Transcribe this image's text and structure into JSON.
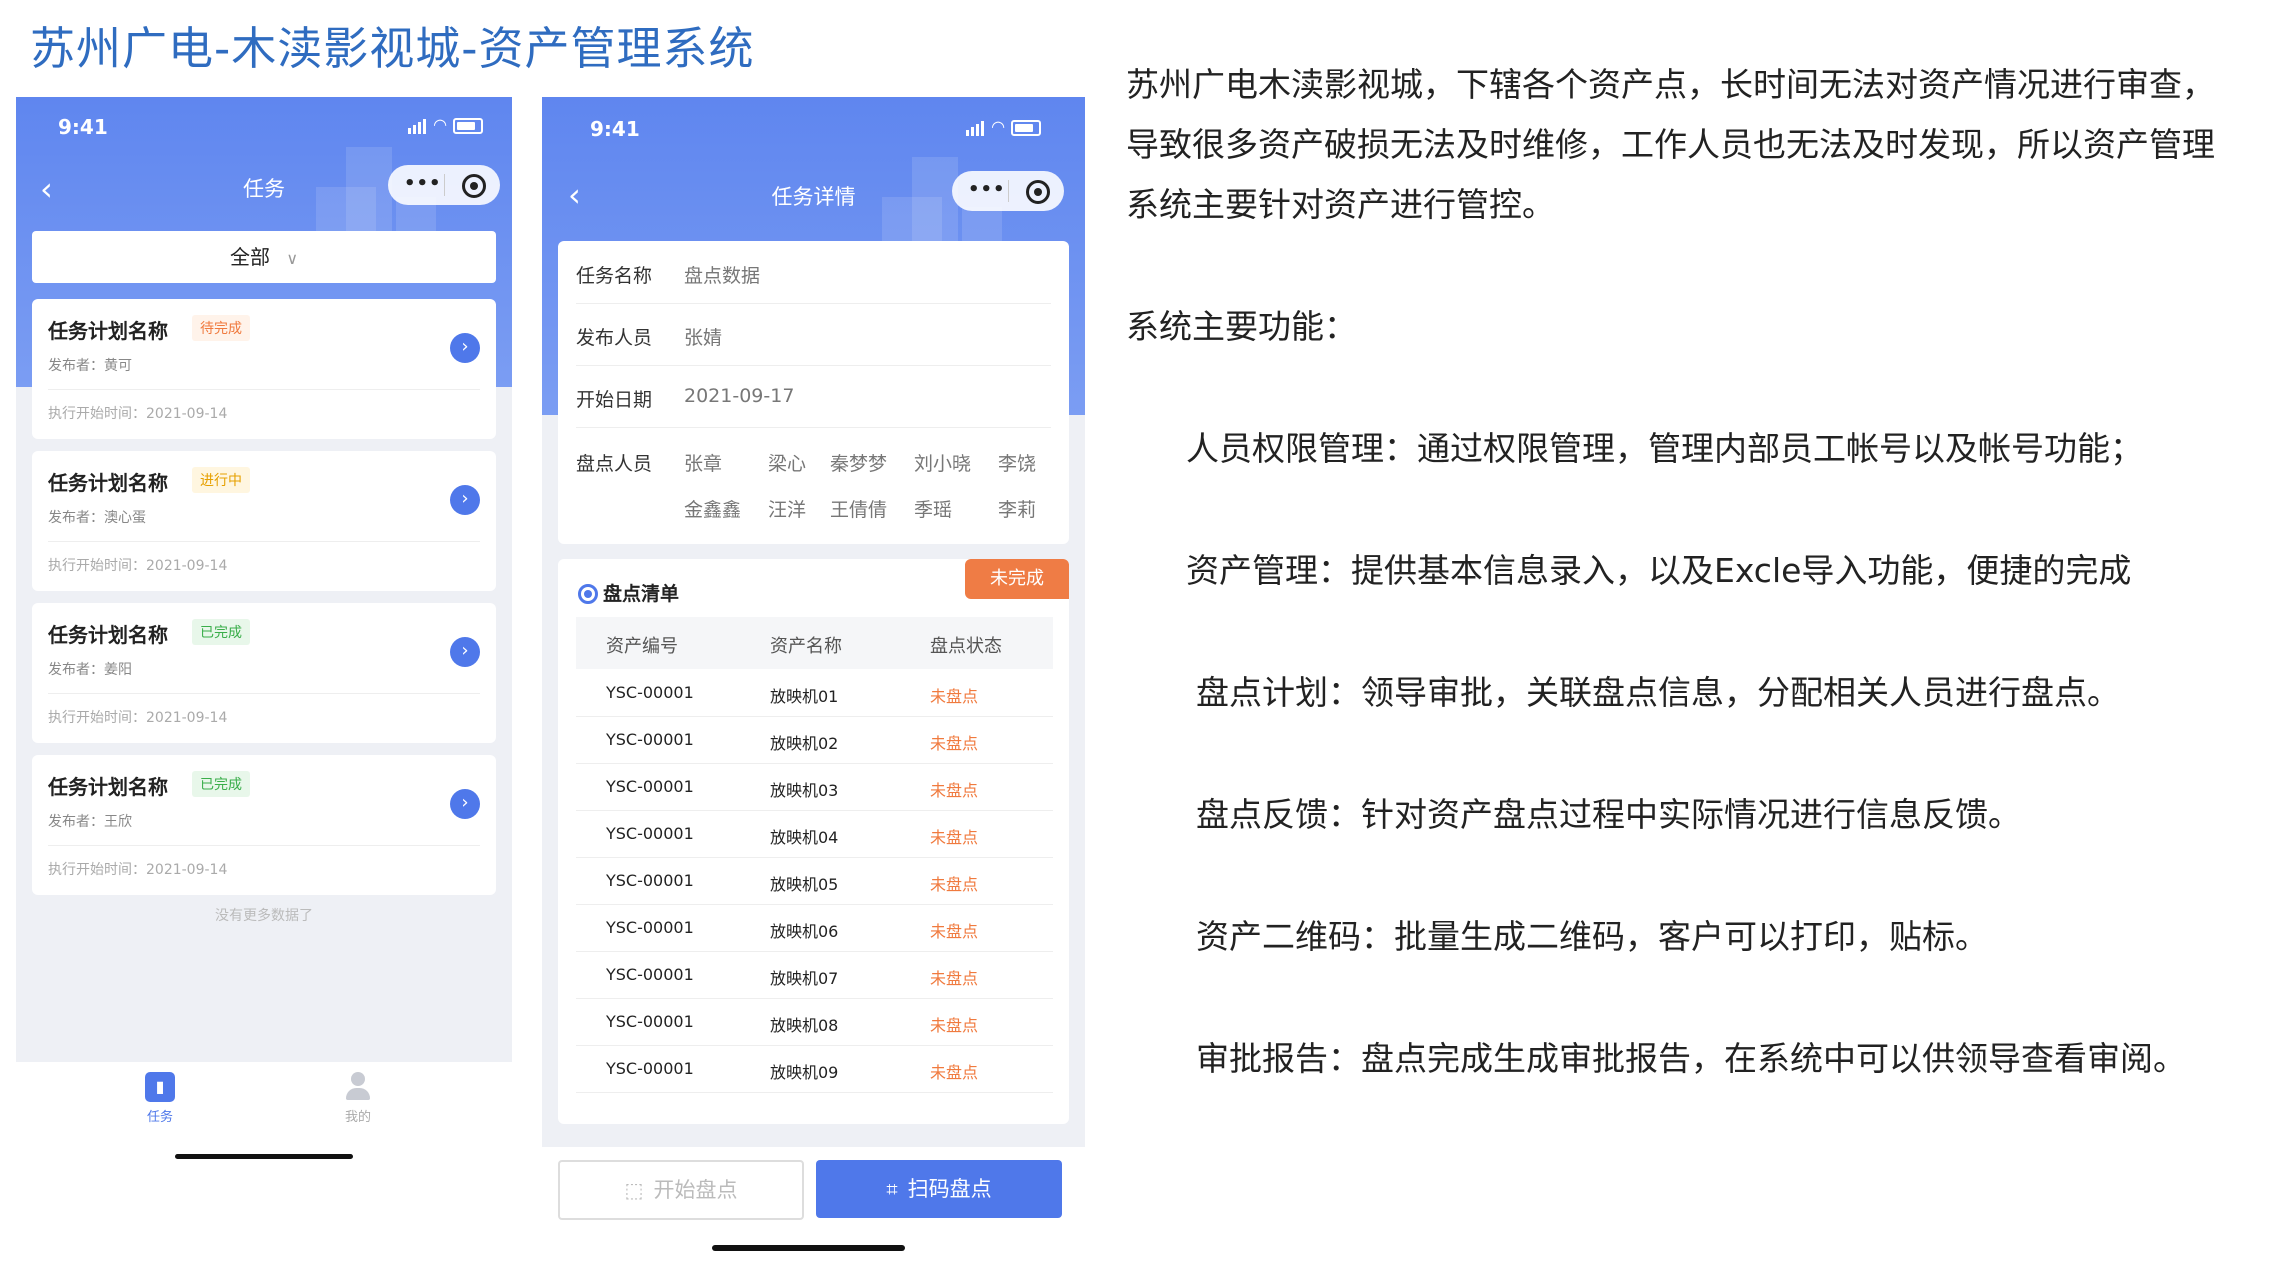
{
  "page_title": "苏州广电-木渎影视城-资产管理系统",
  "colors": {
    "accent": "#4f78ea",
    "title_blue": "#2f6cc0",
    "pending": "#f07a3e",
    "doing": "#e6a000",
    "done": "#3aae4a"
  },
  "phone1": {
    "status_time": "9:41",
    "nav_title": "任务",
    "filter_label": "全部",
    "tasks": [
      {
        "name": "任务计划名称",
        "status": "待完成",
        "publisher": "发布者：黄可",
        "start_time": "执行开始时间：2021-09-14"
      },
      {
        "name": "任务计划名称",
        "status": "进行中",
        "publisher": "发布者：澳心蛋",
        "start_time": "执行开始时间：2021-09-14"
      },
      {
        "name": "任务计划名称",
        "status": "已完成",
        "publisher": "发布者：姜阳",
        "start_time": "执行开始时间：2021-09-14"
      },
      {
        "name": "任务计划名称",
        "status": "已完成",
        "publisher": "发布者：王欣",
        "start_time": "执行开始时间：2021-09-14"
      }
    ],
    "no_more": "没有更多数据了",
    "tabs": [
      {
        "label": "任务",
        "icon": "bar-chart-icon"
      },
      {
        "label": "我的",
        "icon": "user-icon"
      }
    ]
  },
  "phone2": {
    "status_time": "9:41",
    "nav_title": "任务详情",
    "info": {
      "task_name_label": "任务名称",
      "task_name": "盘点数据",
      "publisher_label": "发布人员",
      "publisher": "张婧",
      "start_date_label": "开始日期",
      "start_date": "2021-09-17",
      "people_label": "盘点人员",
      "people": [
        "张章",
        "梁心",
        "秦梦梦",
        "刘小晓",
        "李饶",
        "金鑫鑫",
        "汪洋",
        "王倩倩",
        "季瑶",
        "李莉"
      ]
    },
    "list": {
      "title": "盘点清单",
      "badge": "未完成",
      "columns": [
        "资产编号",
        "资产名称",
        "盘点状态"
      ],
      "rows": [
        [
          "YSC-00001",
          "放映机01",
          "未盘点"
        ],
        [
          "YSC-00001",
          "放映机02",
          "未盘点"
        ],
        [
          "YSC-00001",
          "放映机03",
          "未盘点"
        ],
        [
          "YSC-00001",
          "放映机04",
          "未盘点"
        ],
        [
          "YSC-00001",
          "放映机05",
          "未盘点"
        ],
        [
          "YSC-00001",
          "放映机06",
          "未盘点"
        ],
        [
          "YSC-00001",
          "放映机07",
          "未盘点"
        ],
        [
          "YSC-00001",
          "放映机08",
          "未盘点"
        ],
        [
          "YSC-00001",
          "放映机09",
          "未盘点"
        ]
      ]
    },
    "btn_start": "开始盘点",
    "btn_scan": "扫码盘点"
  },
  "description": {
    "intro_lines": [
      "苏州广电木渎影视城，下辖各个资产点，长时间无法对资产情况进行审查，",
      "导致很多资产破损无法及时维修，工作人员也无法及时发现，所以资产管理",
      "系统主要针对资产进行管控。"
    ],
    "functions_heading": "系统主要功能：",
    "features": [
      "人员权限管理：通过权限管理，管理内部员工帐号以及帐号功能；",
      "资产管理：提供基本信息录入，以及Excle导入功能，便捷的完成",
      "盘点计划：领导审批，关联盘点信息，分配相关人员进行盘点。",
      "盘点反馈：针对资产盘点过程中实际情况进行信息反馈。",
      "资产二维码：批量生成二维码，客户可以打印，贴标。",
      "审批报告：盘点完成生成审批报告，在系统中可以供领导查看审阅。"
    ]
  }
}
